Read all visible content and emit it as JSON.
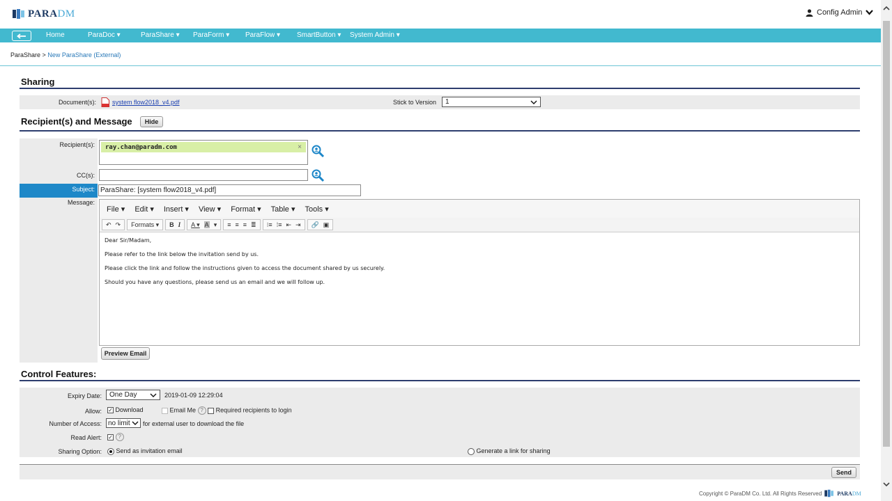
{
  "header": {
    "logo_primary": "PARA",
    "logo_secondary": "DM",
    "user_name": "Config Admin"
  },
  "nav": {
    "items": [
      "Home",
      "ParaDoc ▾",
      "ParaShare ▾",
      "ParaForm ▾",
      "ParaFlow ▾",
      "SmartButton ▾",
      "System Admin ▾"
    ]
  },
  "breadcrumb": {
    "root": "ParaShare",
    "separator": ">",
    "current": "New ParaShare (External)"
  },
  "sharing": {
    "title": "Sharing",
    "document_label": "Document(s):",
    "document_name": "system flow2018_v4.pdf",
    "stick_label": "Stick to Version",
    "stick_value": "1"
  },
  "recipients": {
    "title": "Recipient(s) and Message",
    "hide_label": "Hide",
    "recipient_label": "Recipient(s):",
    "recipient_tag": "ray.chan@paradm.com",
    "remove_glyph": "×",
    "cc_label": "CC(s):",
    "cc_value": "",
    "subject_label": "Subject:",
    "subject_value": "ParaShare: [system flow2018_v4.pdf]",
    "message_label": "Message:"
  },
  "editor": {
    "menus": [
      "File ▾",
      "Edit ▾",
      "Insert ▾",
      "View ▾",
      "Format ▾",
      "Table ▾",
      "Tools ▾"
    ],
    "formats_label": "Formats ▾",
    "body": [
      "Dear Sir/Madam,",
      "Please refer to the link below the invitation send by us.",
      "Please click the link and follow the instructions given to access the document shared by us securely.",
      "Should you have any questions, please send us an email and we will follow up."
    ],
    "preview_label": "Preview Email"
  },
  "control": {
    "title": "Control Features:",
    "expiry_label": "Expiry Date:",
    "expiry_value": "One Day",
    "expiry_datetime": "2019-01-09 12:29:04",
    "allow_label": "Allow:",
    "download_label": "Download",
    "download_checked": true,
    "emailme_label": "Email Me",
    "emailme_checked": false,
    "required_login_label": "Required recipients to login",
    "required_login_checked": false,
    "access_label": "Number of Access:",
    "access_value": "no limit",
    "access_suffix": "for external user to download the file",
    "read_alert_label": "Read Alert:",
    "read_alert_checked": true,
    "sharing_option_label": "Sharing Option:",
    "option_invite": "Send as invitation email",
    "option_link": "Generate a link for sharing",
    "selected_option": "invite"
  },
  "actions": {
    "send_label": "Send"
  },
  "footer": {
    "copyright": "Copyright © ParaDM Co. Ltd. All Rights Reserved"
  },
  "colors": {
    "nav": "#42b9cf",
    "section_line": "#2d3d6e",
    "subject_label_bg": "#1e88c8",
    "tag_bg": "#d8efa6"
  }
}
